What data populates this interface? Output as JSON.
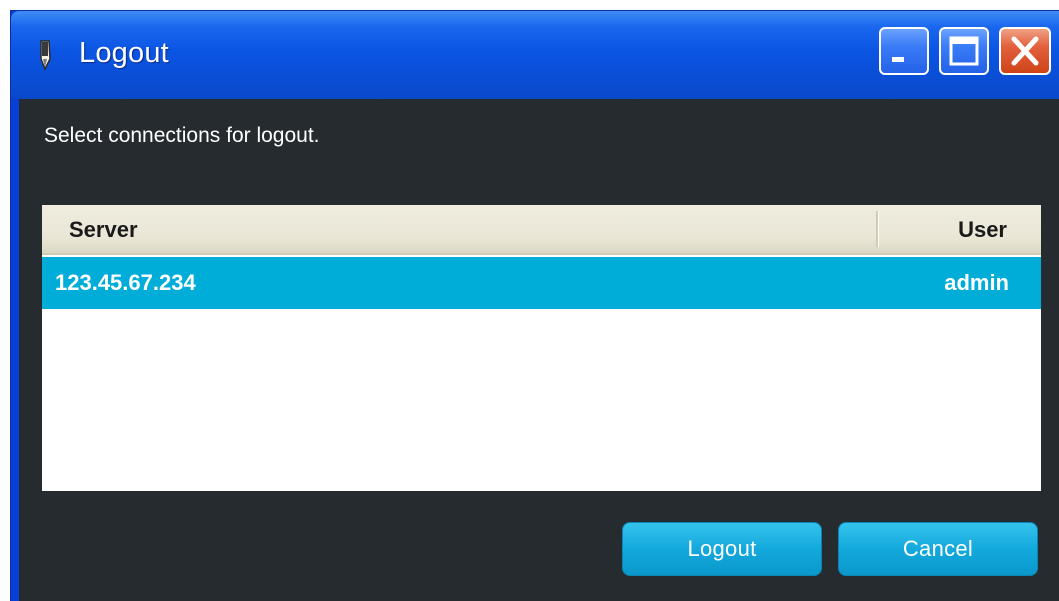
{
  "window": {
    "title": "Logout",
    "app_icon": "pen-icon",
    "controls": {
      "minimize": "minimize-icon",
      "maximize": "maximize-icon",
      "close": "close-icon"
    }
  },
  "dialog": {
    "prompt": "Select connections for logout."
  },
  "connections": {
    "columns": {
      "server": "Server",
      "user": "User"
    },
    "rows": [
      {
        "server": "123.45.67.234",
        "user": "admin",
        "selected": true
      }
    ]
  },
  "buttons": {
    "logout": "Logout",
    "cancel": "Cancel"
  },
  "colors": {
    "title_bar": "#0a55e4",
    "client_bg": "#262b30",
    "selection": "#00acd8",
    "button": "#13a9dc",
    "close_button": "#e2603e"
  }
}
